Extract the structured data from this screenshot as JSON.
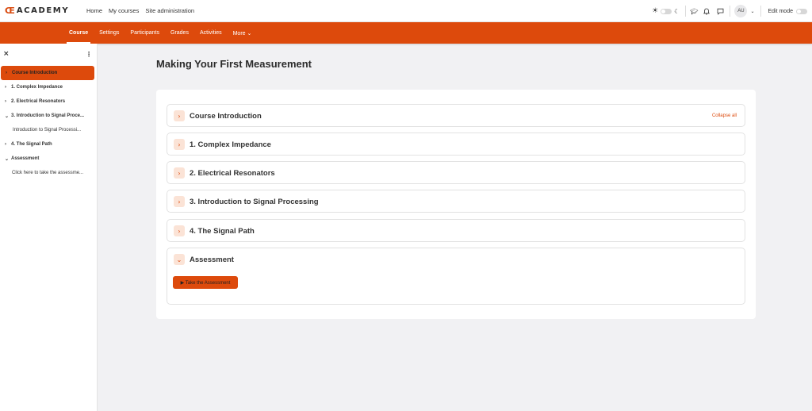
{
  "brand": {
    "logo_mark": "Œ",
    "name": "ACADEMY"
  },
  "topnav": {
    "home": "Home",
    "my_courses": "My courses",
    "site_admin": "Site administration"
  },
  "user": {
    "initials": "AU",
    "edit_mode_label": "Edit mode"
  },
  "secondary_nav": {
    "tabs": [
      {
        "label": "Course"
      },
      {
        "label": "Settings"
      },
      {
        "label": "Participants"
      },
      {
        "label": "Grades"
      },
      {
        "label": "Activities"
      },
      {
        "label": "More ⌄"
      }
    ]
  },
  "drawer": {
    "items": [
      {
        "label": "Course Introduction"
      },
      {
        "label": "1. Complex Impedance"
      },
      {
        "label": "2. Electrical Resonators"
      },
      {
        "label": "3. Introduction to Signal Proce..."
      },
      {
        "label": "Introduction to Signal Processi..."
      },
      {
        "label": "4. The Signal Path"
      },
      {
        "label": "Assessment"
      },
      {
        "label": "Click here to take the assessme..."
      }
    ]
  },
  "main": {
    "title": "Making Your First Measurement",
    "collapse_all": "Collapse all",
    "sections": [
      {
        "title": "Course Introduction"
      },
      {
        "title": "1. Complex Impedance"
      },
      {
        "title": "2. Electrical Resonators"
      },
      {
        "title": "3. Introduction to Signal Processing"
      },
      {
        "title": "4. The Signal Path"
      },
      {
        "title": "Assessment"
      }
    ],
    "assessment_button": "▶ Take the Assessment"
  },
  "colors": {
    "accent": "#dd4a0c",
    "accent_light": "#fbe3d6"
  }
}
